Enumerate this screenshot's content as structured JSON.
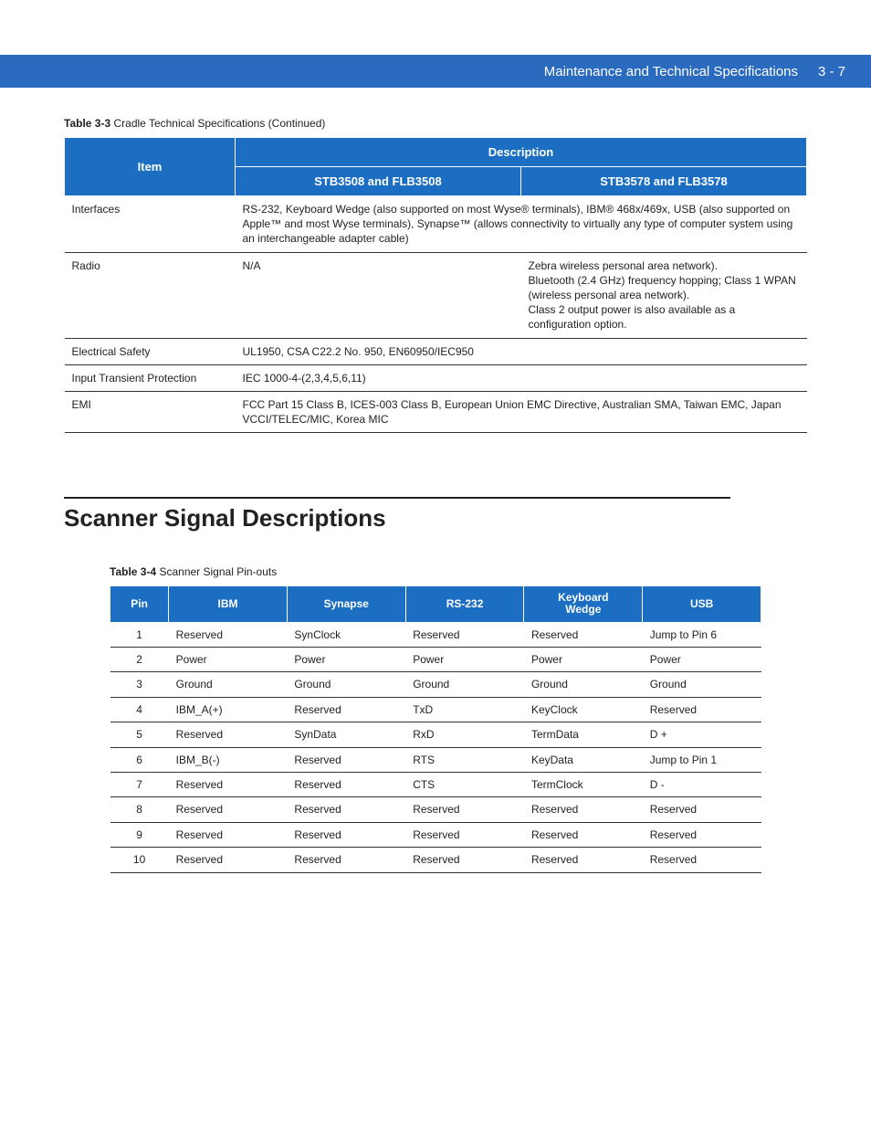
{
  "header": {
    "title": "Maintenance and Technical Specifications",
    "page_num": "3 - 7"
  },
  "table33": {
    "label": "Table 3-3",
    "label_suffix": "Cradle Technical Specifications (Continued)",
    "head": {
      "item": "Item",
      "desc": "Description",
      "colA": "STB3508 and FLB3508",
      "colB": "STB3578 and FLB3578"
    },
    "rows": [
      {
        "item": "Interfaces",
        "span": true,
        "val": "RS-232, Keyboard Wedge (also supported on most Wyse® terminals), IBM® 468x/469x, USB (also supported on Apple™ and most Wyse terminals), Synapse™ (allows connectivity to virtually any type of computer system using an interchangeable adapter cable)"
      },
      {
        "item": "Radio",
        "span": false,
        "a": "N/A",
        "b": "Zebra wireless personal area network).\nBluetooth (2.4 GHz) frequency hopping; Class 1 WPAN (wireless personal area network).\nClass 2 output power is also available as a configuration option."
      },
      {
        "item": "Electrical Safety",
        "span": true,
        "val": "UL1950, CSA C22.2 No. 950, EN60950/IEC950"
      },
      {
        "item": "Input Transient Protection",
        "span": true,
        "val": "IEC 1000-4-(2,3,4,5,6,11)"
      },
      {
        "item": "EMI",
        "span": true,
        "val": "FCC Part 15 Class B, ICES-003 Class B, European Union EMC Directive, Australian SMA, Taiwan EMC, Japan VCCI/TELEC/MIC, Korea MIC"
      }
    ]
  },
  "section_title": "Scanner Signal Descriptions",
  "table34": {
    "label": "Table 3-4",
    "label_suffix": "Scanner Signal Pin-outs",
    "head": {
      "pin": "Pin",
      "ibm": "IBM",
      "synapse": "Synapse",
      "rs232": "RS-232",
      "kw_l1": "Keyboard",
      "kw_l2": "Wedge",
      "usb": "USB"
    },
    "rows": [
      {
        "pin": "1",
        "ibm": "Reserved",
        "syn": "SynClock",
        "rs": "Reserved",
        "kw": "Reserved",
        "usb": "Jump to Pin 6"
      },
      {
        "pin": "2",
        "ibm": "Power",
        "syn": "Power",
        "rs": "Power",
        "kw": "Power",
        "usb": "Power"
      },
      {
        "pin": "3",
        "ibm": "Ground",
        "syn": "Ground",
        "rs": "Ground",
        "kw": "Ground",
        "usb": "Ground"
      },
      {
        "pin": "4",
        "ibm": "IBM_A(+)",
        "syn": "Reserved",
        "rs": "TxD",
        "kw": "KeyClock",
        "usb": "Reserved"
      },
      {
        "pin": "5",
        "ibm": "Reserved",
        "syn": "SynData",
        "rs": "RxD",
        "kw": "TermData",
        "usb": "D +"
      },
      {
        "pin": "6",
        "ibm": "IBM_B(-)",
        "syn": "Reserved",
        "rs": "RTS",
        "kw": "KeyData",
        "usb": "Jump to Pin 1"
      },
      {
        "pin": "7",
        "ibm": "Reserved",
        "syn": "Reserved",
        "rs": "CTS",
        "kw": "TermClock",
        "usb": "D -"
      },
      {
        "pin": "8",
        "ibm": "Reserved",
        "syn": "Reserved",
        "rs": "Reserved",
        "kw": "Reserved",
        "usb": "Reserved"
      },
      {
        "pin": "9",
        "ibm": "Reserved",
        "syn": "Reserved",
        "rs": "Reserved",
        "kw": "Reserved",
        "usb": "Reserved"
      },
      {
        "pin": "10",
        "ibm": "Reserved",
        "syn": "Reserved",
        "rs": "Reserved",
        "kw": "Reserved",
        "usb": "Reserved"
      }
    ]
  }
}
